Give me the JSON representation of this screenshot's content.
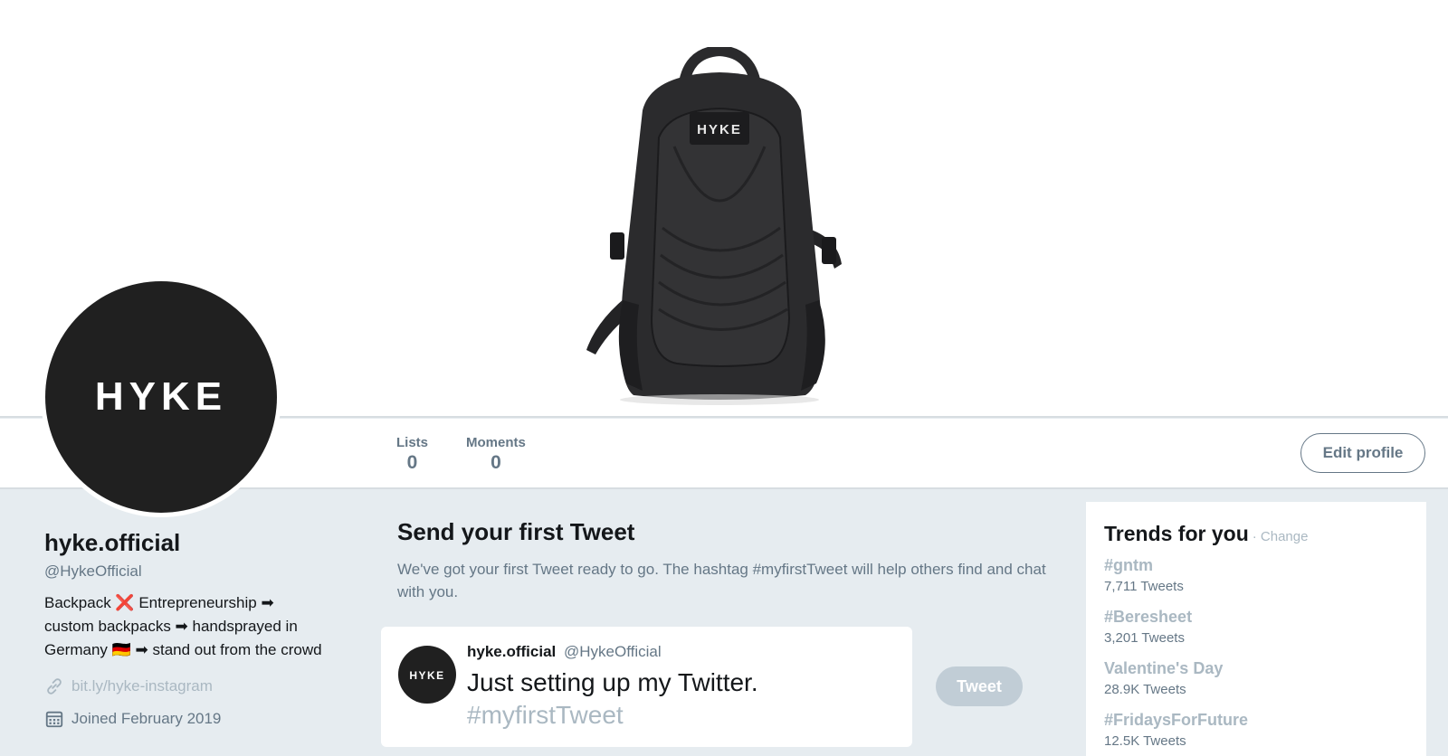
{
  "banner": {
    "backpack_logo": "HYKE"
  },
  "avatar": {
    "logo": "HYKE"
  },
  "nav": {
    "lists_label": "Lists",
    "lists_count": "0",
    "moments_label": "Moments",
    "moments_count": "0",
    "edit_profile": "Edit profile"
  },
  "profile": {
    "name": "hyke.official",
    "handle": "@HykeOfficial",
    "bio_line1": "Backpack ❌ Entrepreneurship ➡",
    "bio_line2": "custom backpacks ➡ handsprayed in",
    "bio_line3": "Germany 🇩🇪 ➡ stand out from the crowd",
    "link": "bit.ly/hyke-instagram",
    "joined": "Joined February 2019",
    "link_icon": "link-icon",
    "calendar_icon": "calendar-icon"
  },
  "first_tweet": {
    "title": "Send your first Tweet",
    "description": "We've got your first Tweet ready to go. The hashtag #myfirstTweet will help others find and chat with you.",
    "author_name": "hyke.official",
    "author_handle": "@HykeOfficial",
    "text": "Just setting up my Twitter.",
    "hashtag": "#myfirstTweet",
    "tweet_button": "Tweet",
    "avatar_logo": "HYKE"
  },
  "trends": {
    "title": "Trends for you",
    "change": "· Change",
    "items": [
      {
        "name": "#gntm",
        "count": "7,711 Tweets"
      },
      {
        "name": "#Beresheet",
        "count": "3,201 Tweets"
      },
      {
        "name": "Valentine's Day",
        "count": "28.9K Tweets"
      },
      {
        "name": "#FridaysForFuture",
        "count": "12.5K Tweets"
      }
    ]
  },
  "colors": {
    "background": "#e6ecf0",
    "muted_text": "#657786",
    "light_text": "#aab8c2",
    "logo_black": "#202020"
  }
}
